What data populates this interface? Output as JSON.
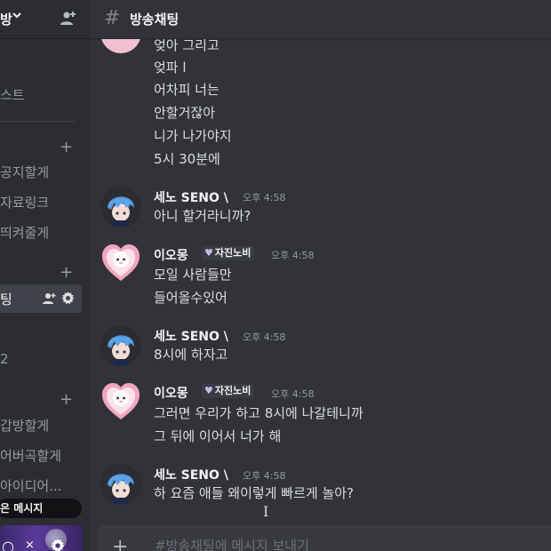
{
  "sidebar": {
    "server_name": "방",
    "rows": [
      {
        "label": "스트"
      },
      {
        "label": "공지할게"
      },
      {
        "label": "자료링크"
      },
      {
        "label": "띄켜줄게"
      },
      {
        "label": "팅"
      },
      {
        "label": "2"
      },
      {
        "label": "갑방할게"
      },
      {
        "label": "어버곡할게"
      },
      {
        "label": "아이디어..."
      }
    ],
    "unread_label": "은 메시지"
  },
  "channel": {
    "name": "방송채팅",
    "input_placeholder": "#방송채팅에 메시지 보내기"
  },
  "messages": {
    "continuation": [
      "엊아 그리고",
      "엊파 l",
      "어차피 너는",
      "안할거잖아",
      "니가 나가야지",
      "5시 30분에"
    ],
    "m1": {
      "author": "세노 SENO \\",
      "time": "오후 4:58",
      "lines": [
        "아니 할거라니까?"
      ]
    },
    "m2": {
      "author": "이오몽",
      "tag": "자진노비",
      "time": "오후 4:58",
      "lines": [
        "모일 사람들만",
        "들어올수있어"
      ]
    },
    "m3": {
      "author": "세노 SENO \\",
      "time": "오후 4:58",
      "lines": [
        "8시에 하자고"
      ]
    },
    "m4": {
      "author": "이오몽",
      "tag": "자진노비",
      "time": "오후 4:58",
      "lines": [
        "그러면 우리가 하고 8시에 나갈테니까",
        "그 뒤에 이어서 너가 해"
      ]
    },
    "m5": {
      "author": "세노 SENO \\",
      "time": "오후 4:58",
      "lines": [
        "하 요즘 애들 왜이렇게 빠르게 놀아?"
      ]
    }
  },
  "icons": {
    "header": "hash-icon",
    "invite": "add-user-icon",
    "settings": "gear-icon"
  },
  "colors": {
    "background": "#313338",
    "sidebar": "#2b2d31",
    "active_channel": "#404249"
  }
}
